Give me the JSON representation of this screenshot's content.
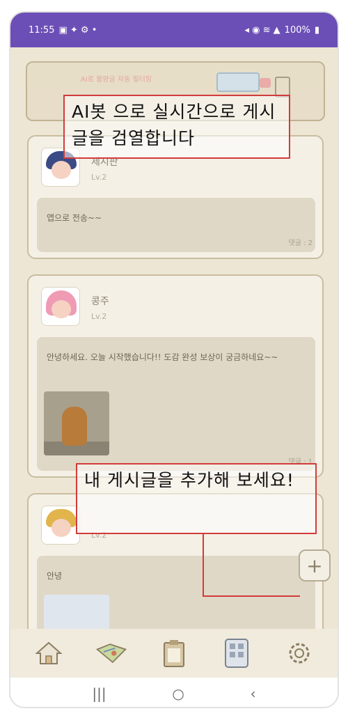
{
  "status_bar": {
    "time": "11:55",
    "battery": "100%"
  },
  "banner": {
    "text": "AI로 불량글 자동 필터링"
  },
  "posts": [
    {
      "username": "제시판",
      "level": "Lv.2",
      "text": "앱으로 전송~~",
      "comments": "댓글 : 2"
    },
    {
      "username": "콩주",
      "level": "Lv.2",
      "text": "안녕하세요. 오늘 시작했습니다!! 도감 완성 보상이 궁금하네요~~",
      "comments": "댓글 : 1"
    },
    {
      "username": "",
      "level": "Lv.2",
      "text": "안녕",
      "comments": ""
    }
  ],
  "annotations": {
    "top": "AI봇 으로  실시간으로 게시글을 검열합니다",
    "bottom": "내 게시글을 추가해 보세요!"
  },
  "fab": {
    "label": "+"
  },
  "bottom_nav": {
    "items": [
      "home-icon",
      "map-icon",
      "clipboard-icon",
      "collection-icon",
      "settings-icon"
    ]
  },
  "system_nav": {
    "recents": "|||",
    "home": "○",
    "back": "‹"
  }
}
